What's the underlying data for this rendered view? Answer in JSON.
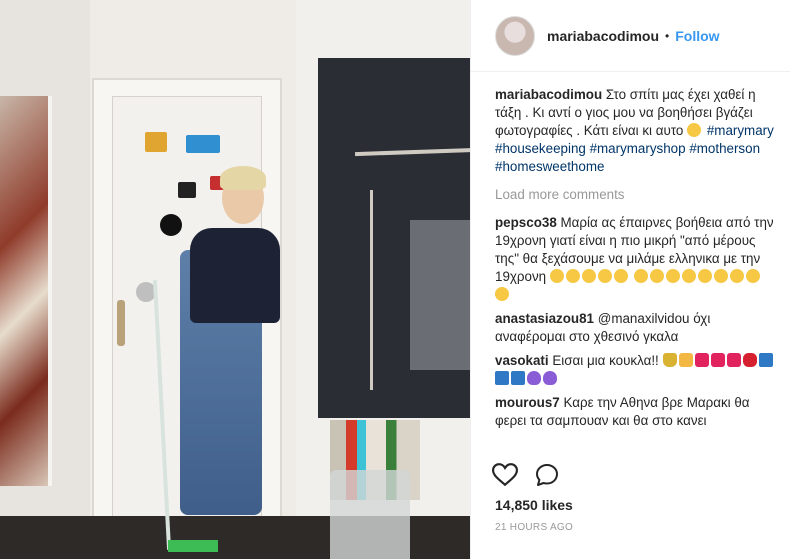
{
  "post": {
    "username": "mariabacodimou",
    "follow_label": "Follow",
    "separator": "•"
  },
  "caption": {
    "user": "mariabacodimou",
    "text": "Στο σπίτι μας έχει χαθεί η τάξη . Κι αντί ο γιος μου να βοηθήσει βγάζει φωτογραφίες . Κάτι είναι κι αυτο",
    "hashtags": [
      "#marymary",
      "#housekeeping",
      "#marymaryshop",
      "#motherson",
      "#homesweethome"
    ]
  },
  "load_more": "Load more comments",
  "comments": [
    {
      "user": "pepsco38",
      "text": "Μαρία ας έπαιρνες βοήθεια από την 19χρονη γιατί είναι η πιο μικρή \"από μέρους της\" θα ξεχάσουμε να μιλάμε ελληνικα με την 19χρονη"
    },
    {
      "user": "anastasiazou81",
      "text": "@manaxilvidou όχι αναφέρομαι στο χθεσινό γκαλα"
    },
    {
      "user": "vasokati",
      "text": "Εισαι μια κουκλα!!"
    },
    {
      "user": "mourous7",
      "text": "Καρε την Αθηνα βρε Μαρακι θα φερει τα σαμπουαν και θα στο κανει"
    }
  ],
  "likes": "14,850 likes",
  "timestamp": "21 HOURS AGO",
  "icons": {
    "like": "heart-outline-icon",
    "comment": "speech-bubble-icon"
  }
}
